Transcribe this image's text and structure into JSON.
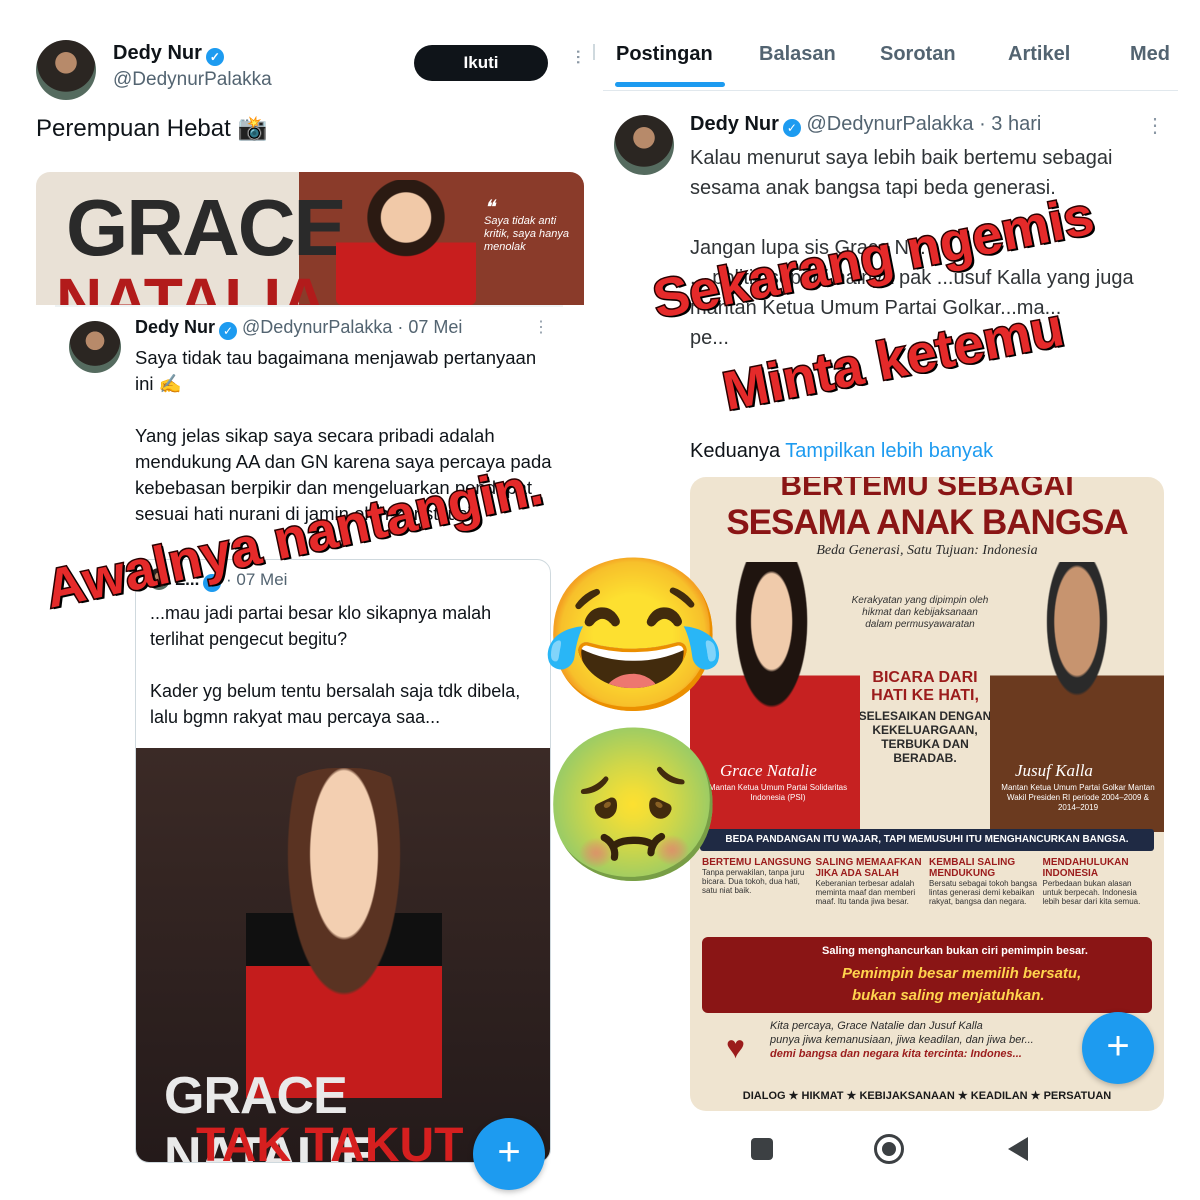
{
  "left_post": {
    "author_name": "Dedy Nur",
    "handle": "@DedynurPalakka",
    "follow_label": "Ikuti",
    "text": "Perempuan Hebat 📸",
    "media_banner": {
      "title_line1": "GRACE",
      "title_line2": "NATALIA",
      "quote": "Saya tidak anti kritik, saya hanya menolak"
    }
  },
  "left_quote": {
    "author_name": "Dedy Nur",
    "handle": "@DedynurPalakka",
    "date": "· 07 Mei",
    "text": "Saya tidak tau bagaimana menjawab pertanyaan ini ✍️\n\nYang jelas sikap saya secara pribadi adalah mendukung AA dan GN karena saya percaya pada kebebasan berpikir dan mengeluarkan pendapat sesuai hati nurani di jamin oleh konstitusi.",
    "nested": {
      "author_fragment": "L...",
      "date": "· 07 Mei",
      "text": "...mau jadi partai besar klo sikapnya malah terlihat pengecut begitu?\n\nKader yg belum tentu bersalah saja tdk dibela, lalu bgmn rakyat mau percaya saa...",
      "poster_title1": "GRACE NATALIE",
      "poster_title2": "TAK TAKUT"
    }
  },
  "right_tabs": [
    "Postingan",
    "Balasan",
    "Sorotan",
    "Artikel",
    "Med"
  ],
  "right_post": {
    "author_name": "Dedy Nur",
    "handle": "@DedynurPalakka",
    "date": "· 3 hari",
    "text": "Kalau menurut saya lebih baik bertemu sebagai sesama anak bangsa tapi beda generasi.\n\nJangan lupa sis Grace N... \n... politik seperti halnya pak ...usuf Kalla yang juga mantan Ketua Umum Partai Golkar...ma...\npe...",
    "keduanya": "Keduanya",
    "show_more": "Tampilkan lebih banyak"
  },
  "infographic": {
    "top": "BERTEMU SEBAGAI",
    "headline": "SESAMA ANAK BANGSA",
    "subtitle": "Beda Generasi, Satu Tujuan: Indonesia",
    "quote": "Kerakyatan yang dipimpin oleh hikmat dan kebijaksanaan dalam permusyawaratan",
    "center1": "BICARA DARI HATI KE HATI,",
    "center2": "SELESAIKAN DENGAN KEKELUARGAAN, TERBUKA DAN BERADAB.",
    "left_name": "Grace Natalie",
    "left_role": "Mantan Ketua Umum Partai Solidaritas Indonesia (PSI)",
    "right_name": "Jusuf Kalla",
    "right_role": "Mantan Ketua Umum Partai Golkar Mantan Wakil Presiden RI periode 2004–2009 & 2014–2019",
    "banner": "BEDA PANDANGAN ITU WAJAR, TAPI MEMUSUHI ITU MENGHANCURKAN BANGSA.",
    "points": [
      {
        "title": "BERTEMU LANGSUNG",
        "desc": "Tanpa perwakilan, tanpa juru bicara. Dua tokoh, dua hati, satu niat baik."
      },
      {
        "title": "SALING MEMAAFKAN JIKA ADA SALAH",
        "desc": "Keberanian terbesar adalah meminta maaf dan memberi maaf. Itu tanda jiwa besar."
      },
      {
        "title": "KEMBALI SALING MENDUKUNG",
        "desc": "Bersatu sebagai tokoh bangsa lintas generasi demi kebaikan rakyat, bangsa dan negara."
      },
      {
        "title": "MENDAHULUKAN INDONESIA",
        "desc": "Perbedaan bukan alasan untuk berpecah. Indonesia lebih besar dari kita semua."
      }
    ],
    "band1": "Saling menghancurkan bukan ciri pemimpin besar.",
    "band2": "Pemimpin besar memilih bersatu,",
    "band3": "bukan saling menjatuhkan.",
    "closing1": "Kita percaya, Grace Natalie dan Jusuf Kalla",
    "closing2": "punya jiwa kemanusiaan, jiwa keadilan, dan jiwa ber...",
    "closing3": "demi bangsa dan negara kita tercinta: Indones...",
    "footer": "DIALOG ★ HIKMAT ★ KEBIJAKSANAAN ★ KEADILAN ★ PERSATUAN"
  },
  "overlays": {
    "left": "Awalnya nantangin.",
    "right1": "Sekarang ngemis",
    "right2": "Minta ketemu"
  },
  "emojis": {
    "laugh": "😂",
    "sick": "🤢"
  },
  "fab_label": "+",
  "colors": {
    "accent": "#1d9bf0",
    "overlay_red": "#e52a2a",
    "infographic_red": "#9b1c1c"
  }
}
